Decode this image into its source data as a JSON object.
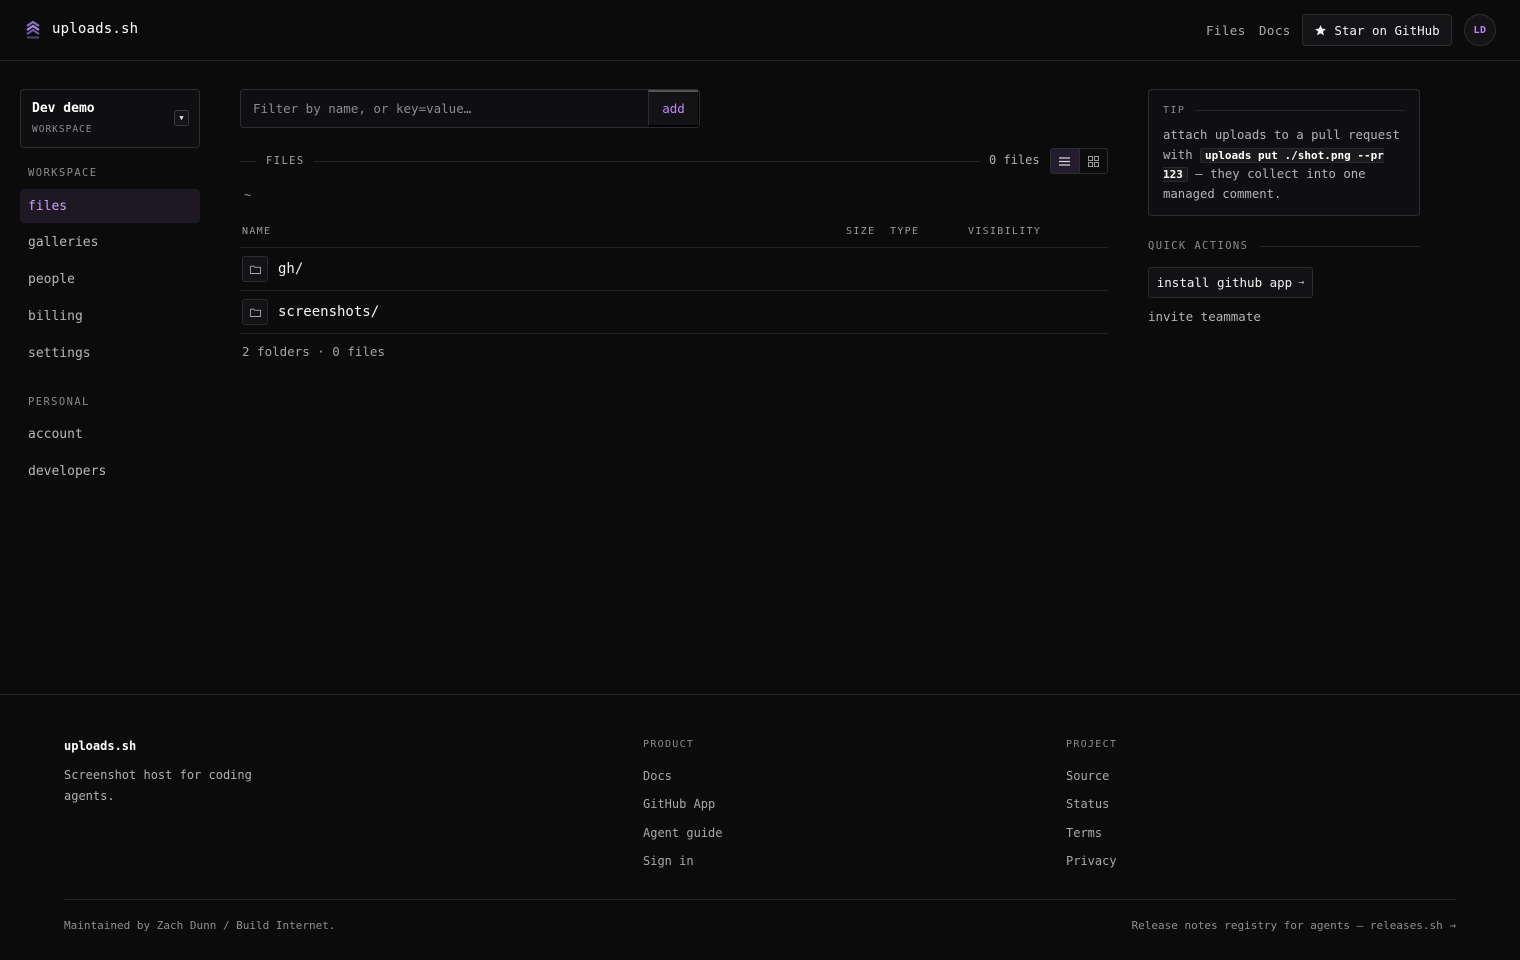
{
  "header": {
    "brand": "uploads.sh",
    "nav": [
      {
        "label": "Files"
      },
      {
        "label": "Docs"
      }
    ],
    "github_button": "Star on GitHub",
    "avatar_initials": "LD"
  },
  "workspace": {
    "name": "Dev demo",
    "subtitle": "WORKSPACE"
  },
  "sidebar": {
    "workspace_label": "WORKSPACE",
    "workspace_items": [
      {
        "label": "files",
        "active": true
      },
      {
        "label": "galleries"
      },
      {
        "label": "people"
      },
      {
        "label": "billing"
      },
      {
        "label": "settings"
      }
    ],
    "personal_label": "PERSONAL",
    "personal_items": [
      {
        "label": "account"
      },
      {
        "label": "developers"
      }
    ]
  },
  "main": {
    "filter": {
      "placeholder": "Filter by name, or key=value…",
      "value": "",
      "add_label": "add"
    },
    "section_label": "FILES",
    "file_count": "0 files",
    "breadcrumb": "~",
    "columns": [
      "NAME",
      "SIZE",
      "TYPE",
      "VISIBILITY"
    ],
    "rows": [
      {
        "name": "gh/",
        "icon": "folder-icon"
      },
      {
        "name": "screenshots/",
        "icon": "folder-icon"
      }
    ],
    "summary": "2 folders · 0 files"
  },
  "tip": {
    "label": "TIP",
    "text_before": "attach uploads to a pull request with",
    "code": "uploads put ./shot.png --pr 123",
    "text_after": "— they collect into one managed comment."
  },
  "quick_actions": {
    "label": "QUICK ACTIONS",
    "primary": "install github app",
    "secondary": "invite teammate"
  },
  "footer": {
    "brand": "uploads.sh",
    "tagline": "Screenshot host for coding agents.",
    "product_label": "PRODUCT",
    "product_links": [
      "Docs",
      "GitHub App",
      "Agent guide",
      "Sign in"
    ],
    "project_label": "PROJECT",
    "project_links": [
      "Source",
      "Status",
      "Terms",
      "Privacy"
    ],
    "maintained": "Maintained by Zach Dunn / Build Internet.",
    "release_link": "Release notes registry for agents — releases.sh"
  },
  "colors": {
    "accent": "#c084fc",
    "background": "#0b0b0c",
    "border": "#2d2d31"
  }
}
